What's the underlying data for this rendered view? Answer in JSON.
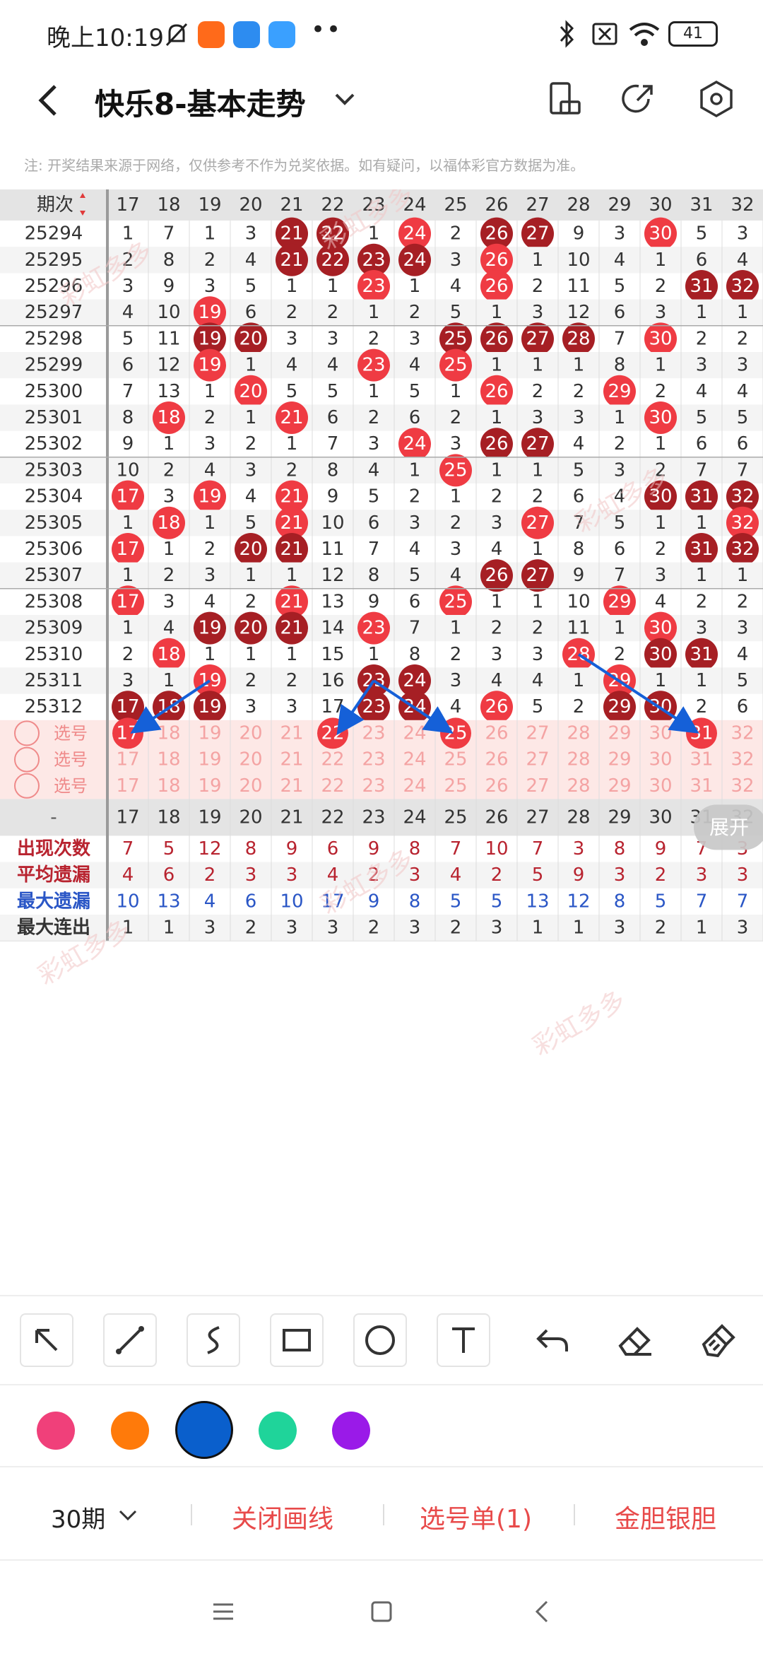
{
  "status_bar": {
    "time": "晚上10:19",
    "battery": "41",
    "extra_dots": "••"
  },
  "header": {
    "title": "快乐8-基本走势"
  },
  "notice": "注: 开奖结果来源于网络，仅供参考不作为兑奖依据。如有疑问，以福体彩官方数据为准。",
  "table": {
    "issue_header": "期次",
    "columns": [
      "17",
      "18",
      "19",
      "20",
      "21",
      "22",
      "23",
      "24",
      "25",
      "26",
      "27",
      "28",
      "29",
      "30",
      "31",
      "32"
    ],
    "rows": [
      {
        "issue": "25294",
        "cells": [
          "1",
          "7",
          "1",
          "3",
          "21",
          "22",
          "1",
          "24",
          "2",
          "26",
          "27",
          "9",
          "3",
          "30",
          "5",
          "3"
        ],
        "hits": [
          4,
          5,
          7,
          9,
          10,
          13
        ]
      },
      {
        "issue": "25295",
        "cells": [
          "2",
          "8",
          "2",
          "4",
          "21",
          "22",
          "23",
          "24",
          "3",
          "26",
          "1",
          "10",
          "4",
          "1",
          "6",
          "4"
        ],
        "hits": [
          4,
          5,
          6,
          7,
          9
        ]
      },
      {
        "issue": "25296",
        "cells": [
          "3",
          "9",
          "3",
          "5",
          "1",
          "1",
          "23",
          "1",
          "4",
          "26",
          "2",
          "11",
          "5",
          "2",
          "31",
          "32"
        ],
        "hits": [
          6,
          9,
          14,
          15
        ]
      },
      {
        "issue": "25297",
        "cells": [
          "4",
          "10",
          "19",
          "6",
          "2",
          "2",
          "1",
          "2",
          "5",
          "1",
          "3",
          "12",
          "6",
          "3",
          "1",
          "1"
        ],
        "hits": [
          2
        ]
      },
      {
        "issue": "25298",
        "cells": [
          "5",
          "11",
          "19",
          "20",
          "3",
          "3",
          "2",
          "3",
          "25",
          "26",
          "27",
          "28",
          "7",
          "30",
          "2",
          "2"
        ],
        "hits": [
          2,
          3,
          8,
          9,
          10,
          11,
          13
        ]
      },
      {
        "issue": "25299",
        "cells": [
          "6",
          "12",
          "19",
          "1",
          "4",
          "4",
          "23",
          "4",
          "25",
          "1",
          "1",
          "1",
          "8",
          "1",
          "3",
          "3"
        ],
        "hits": [
          2,
          6,
          8
        ]
      },
      {
        "issue": "25300",
        "cells": [
          "7",
          "13",
          "1",
          "20",
          "5",
          "5",
          "1",
          "5",
          "1",
          "26",
          "2",
          "2",
          "29",
          "2",
          "4",
          "4"
        ],
        "hits": [
          3,
          9,
          12
        ]
      },
      {
        "issue": "25301",
        "cells": [
          "8",
          "18",
          "2",
          "1",
          "21",
          "6",
          "2",
          "6",
          "2",
          "1",
          "3",
          "3",
          "1",
          "30",
          "5",
          "5"
        ],
        "hits": [
          1,
          4,
          13
        ]
      },
      {
        "issue": "25302",
        "cells": [
          "9",
          "1",
          "3",
          "2",
          "1",
          "7",
          "3",
          "24",
          "3",
          "26",
          "27",
          "4",
          "2",
          "1",
          "6",
          "6"
        ],
        "hits": [
          7,
          9,
          10
        ]
      },
      {
        "issue": "25303",
        "cells": [
          "10",
          "2",
          "4",
          "3",
          "2",
          "8",
          "4",
          "1",
          "25",
          "1",
          "1",
          "5",
          "3",
          "2",
          "7",
          "7"
        ],
        "hits": [
          8
        ]
      },
      {
        "issue": "25304",
        "cells": [
          "17",
          "3",
          "19",
          "4",
          "21",
          "9",
          "5",
          "2",
          "1",
          "2",
          "2",
          "6",
          "4",
          "30",
          "31",
          "32"
        ],
        "hits": [
          0,
          2,
          4,
          13,
          14,
          15
        ]
      },
      {
        "issue": "25305",
        "cells": [
          "1",
          "18",
          "1",
          "5",
          "21",
          "10",
          "6",
          "3",
          "2",
          "3",
          "27",
          "7",
          "5",
          "1",
          "1",
          "32"
        ],
        "hits": [
          1,
          4,
          10,
          15
        ]
      },
      {
        "issue": "25306",
        "cells": [
          "17",
          "1",
          "2",
          "20",
          "21",
          "11",
          "7",
          "4",
          "3",
          "4",
          "1",
          "8",
          "6",
          "2",
          "31",
          "32"
        ],
        "hits": [
          0,
          3,
          4,
          14,
          15
        ]
      },
      {
        "issue": "25307",
        "cells": [
          "1",
          "2",
          "3",
          "1",
          "1",
          "12",
          "8",
          "5",
          "4",
          "26",
          "27",
          "9",
          "7",
          "3",
          "1",
          "1"
        ],
        "hits": [
          9,
          10
        ]
      },
      {
        "issue": "25308",
        "cells": [
          "17",
          "3",
          "4",
          "2",
          "21",
          "13",
          "9",
          "6",
          "25",
          "1",
          "1",
          "10",
          "29",
          "4",
          "2",
          "2"
        ],
        "hits": [
          0,
          4,
          8,
          12
        ]
      },
      {
        "issue": "25309",
        "cells": [
          "1",
          "4",
          "19",
          "20",
          "21",
          "14",
          "23",
          "7",
          "1",
          "2",
          "2",
          "11",
          "1",
          "30",
          "3",
          "3"
        ],
        "hits": [
          2,
          3,
          4,
          6,
          13
        ]
      },
      {
        "issue": "25310",
        "cells": [
          "2",
          "18",
          "1",
          "1",
          "1",
          "15",
          "1",
          "8",
          "2",
          "3",
          "3",
          "28",
          "2",
          "30",
          "31",
          "4"
        ],
        "hits": [
          1,
          11,
          13,
          14
        ]
      },
      {
        "issue": "25311",
        "cells": [
          "3",
          "1",
          "19",
          "2",
          "2",
          "16",
          "23",
          "24",
          "3",
          "4",
          "4",
          "1",
          "29",
          "1",
          "1",
          "5"
        ],
        "hits": [
          2,
          6,
          7,
          12
        ]
      },
      {
        "issue": "25312",
        "cells": [
          "17",
          "18",
          "19",
          "3",
          "3",
          "17",
          "23",
          "24",
          "4",
          "26",
          "5",
          "2",
          "29",
          "30",
          "2",
          "6"
        ],
        "hits": [
          0,
          1,
          2,
          6,
          7,
          9,
          12,
          13
        ]
      }
    ],
    "pick_label": "选号",
    "pick_rows": 3,
    "picked": [
      0,
      5,
      8,
      14
    ],
    "summary_dash": "-",
    "stats": [
      {
        "label": "出现次数",
        "color": "#b8232f",
        "values": [
          "7",
          "5",
          "12",
          "8",
          "9",
          "6",
          "9",
          "8",
          "7",
          "10",
          "7",
          "3",
          "8",
          "9",
          "7",
          "3"
        ]
      },
      {
        "label": "平均遗漏",
        "color": "#b8232f",
        "values": [
          "4",
          "6",
          "2",
          "3",
          "3",
          "4",
          "2",
          "3",
          "4",
          "2",
          "5",
          "9",
          "3",
          "2",
          "3",
          "3"
        ]
      },
      {
        "label": "最大遗漏",
        "color": "#2a56c6",
        "values": [
          "10",
          "13",
          "4",
          "6",
          "10",
          "17",
          "9",
          "8",
          "5",
          "5",
          "13",
          "12",
          "8",
          "5",
          "7",
          "7"
        ]
      },
      {
        "label": "最大连出",
        "color": "#333333",
        "values": [
          "1",
          "1",
          "3",
          "2",
          "3",
          "3",
          "2",
          "3",
          "2",
          "3",
          "1",
          "1",
          "3",
          "2",
          "1",
          "3"
        ]
      }
    ],
    "expand_label": "展开"
  },
  "arrows": [
    [
      2,
      17,
      0,
      19
    ],
    [
      6,
      17,
      5,
      19
    ],
    [
      6,
      17,
      8,
      19
    ],
    [
      11,
      16,
      14,
      19
    ]
  ],
  "tools": [
    "select-arrow",
    "line",
    "curve",
    "rectangle",
    "circle",
    "text",
    "undo",
    "eraser",
    "clear-brush"
  ],
  "palette": [
    "#f0407a",
    "#ff7a0a",
    "#0a5fcc",
    "#1fd49a",
    "#9a1ae8"
  ],
  "selected_color": 2,
  "bottom": {
    "period": "30期",
    "close_lines": "关闭画线",
    "pick_list": "选号单(1)",
    "gold_silver": "金胆银胆"
  },
  "watermark": "彩虹多多",
  "colors": {
    "hit_red": "#ef3b43",
    "hit_dark": "#a61f24",
    "arrow": "#1560d8",
    "pick_bg": "#fde8e6"
  }
}
